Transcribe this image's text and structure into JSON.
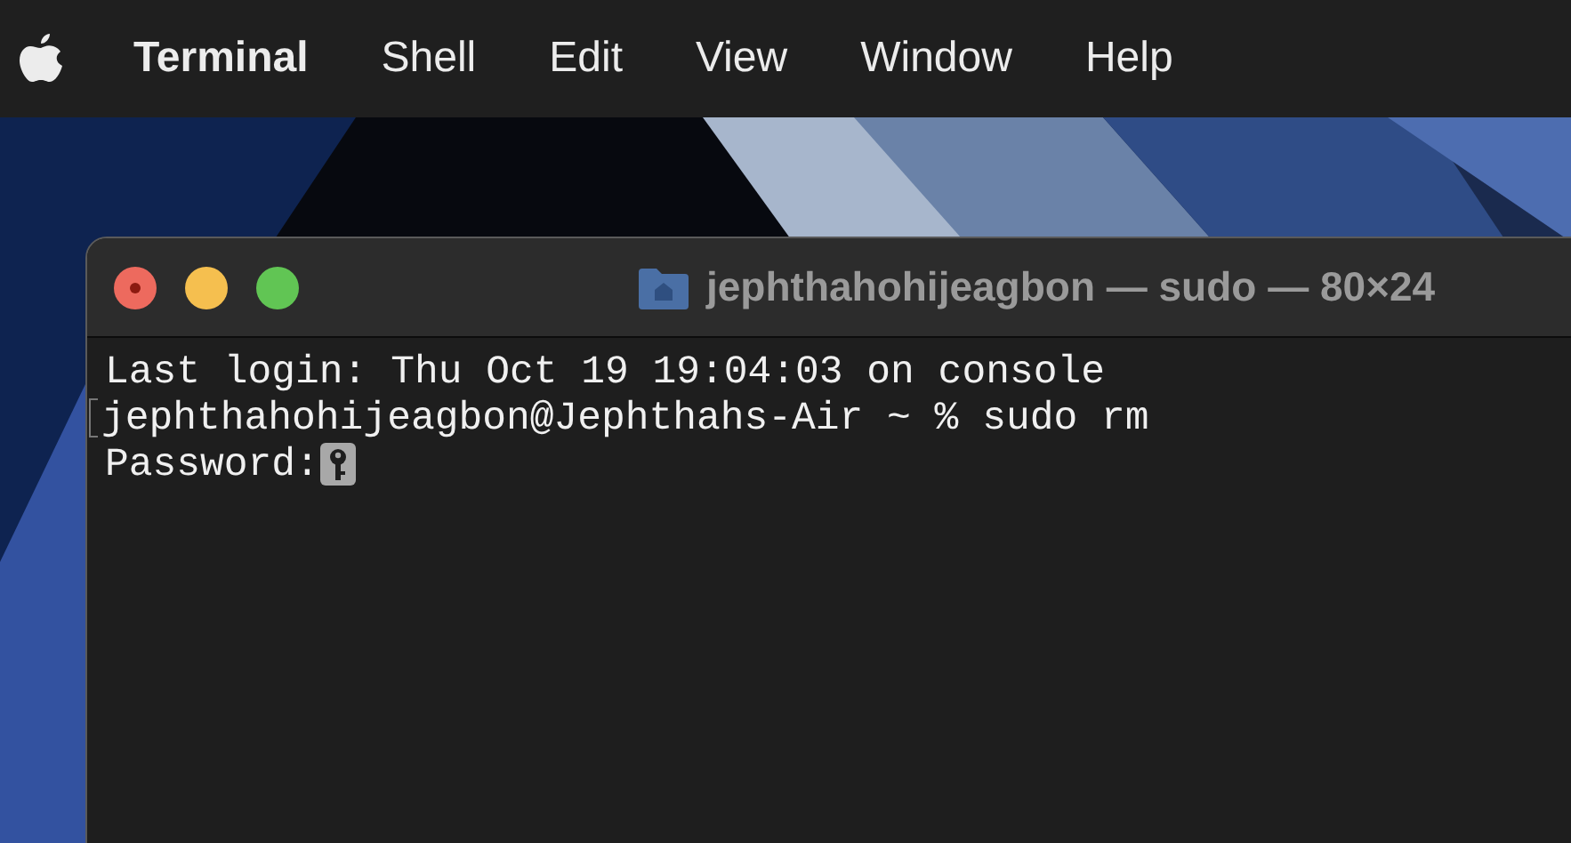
{
  "menu_bar": {
    "items": [
      {
        "label": "Terminal",
        "kind": "app"
      },
      {
        "label": "Shell",
        "kind": "menu"
      },
      {
        "label": "Edit",
        "kind": "menu"
      },
      {
        "label": "View",
        "kind": "menu"
      },
      {
        "label": "Window",
        "kind": "menu"
      },
      {
        "label": "Help",
        "kind": "menu"
      }
    ]
  },
  "window": {
    "title": "jephthahohijeagbon — sudo — 80×24",
    "lines": [
      {
        "text": "Last login: Thu Oct 19 19:04:03 on console",
        "kind": "output"
      },
      {
        "text": "jephthahohijeagbon@Jephthahs-Air ~ % sudo rm",
        "kind": "prompt"
      },
      {
        "text": "Password:",
        "kind": "password"
      }
    ]
  }
}
